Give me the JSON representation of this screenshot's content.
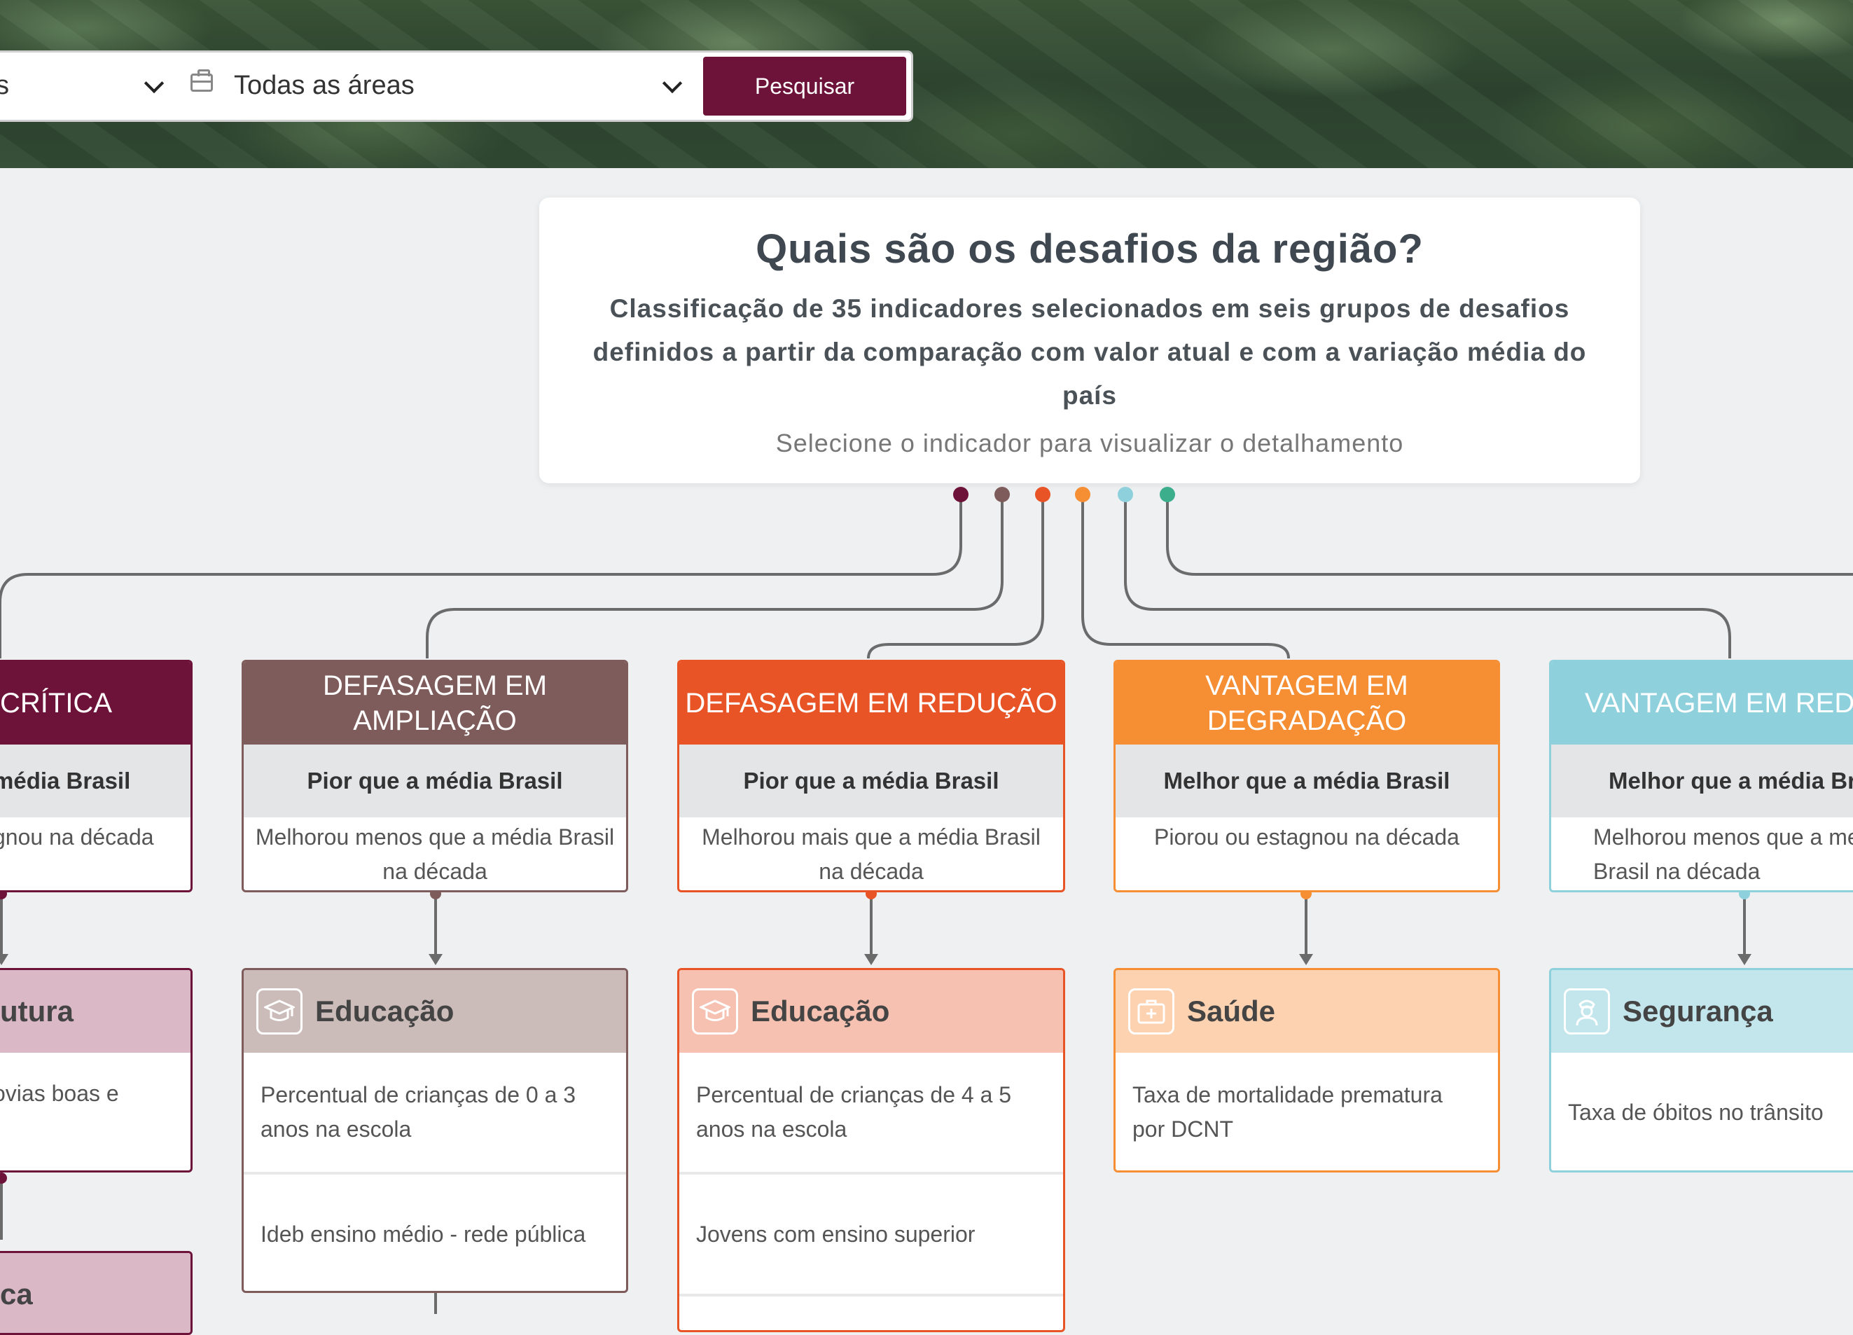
{
  "search": {
    "left_value": "s",
    "area_value": "Todas as áreas",
    "button_label": "Pesquisar"
  },
  "intro": {
    "title": "Quais são os desafios da região?",
    "subtitle": "Classificação de 35 indicadores selecionados em seis grupos de desafios definidos a partir da comparação com valor atual e com a variação média do país",
    "hint": "Selecione o indicador para visualizar o detalhamento"
  },
  "colors": {
    "critica": "#6d1238",
    "ampliacao": "#7e5c5b",
    "reducao": "#e85426",
    "degradacao": "#f68e33",
    "vantagem_reducao": "#8fd0dd",
    "vantagem_extra": "#3cae8c"
  },
  "groups": [
    {
      "title": "CRÍTICA",
      "comparison": "média Brasil",
      "variation": "gnou na década"
    },
    {
      "title": "DEFASAGEM EM AMPLIAÇÃO",
      "comparison": "Pior que a média Brasil",
      "variation": "Melhorou menos que a média Brasil na década"
    },
    {
      "title": "DEFASAGEM EM REDUÇÃO",
      "comparison": "Pior que a média Brasil",
      "variation": "Melhorou mais que a média Brasil na década"
    },
    {
      "title": "VANTAGEM EM DEGRADAÇÃO",
      "comparison": "Melhor que a média Brasil",
      "variation": "Piorou ou estagnou na década"
    },
    {
      "title": "VANTAGEM EM REDUÇ",
      "comparison": "Melhor que a média Bra",
      "variation": "Melhorou menos que a me Brasil na década"
    }
  ],
  "areas": [
    {
      "name": "utura",
      "items": [
        "ovias boas e"
      ]
    },
    {
      "name": "Educação",
      "icon": "graduation-cap-icon",
      "items": [
        "Percentual de crianças de 0 a 3 anos na escola",
        "Ideb ensino médio - rede pública"
      ]
    },
    {
      "name": "Educação",
      "icon": "graduation-cap-icon",
      "items": [
        "Percentual de crianças de 4 a 5 anos na escola",
        "Jovens com ensino superior"
      ]
    },
    {
      "name": "Saúde",
      "icon": "medical-kit-icon",
      "items": [
        "Taxa de mortalidade prematura por DCNT"
      ]
    },
    {
      "name": "Segurança",
      "icon": "police-officer-icon",
      "items": [
        "Taxa de óbitos no trânsito"
      ]
    },
    {
      "name": "ca",
      "items": []
    }
  ]
}
